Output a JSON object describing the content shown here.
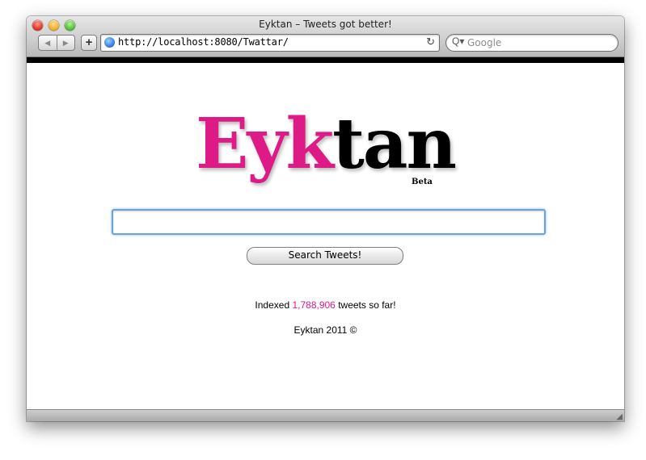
{
  "window": {
    "title": "Eyktan – Tweets got better!",
    "url": "http://localhost:8080/Twattar/",
    "search_placeholder": "Google"
  },
  "toolbar": {
    "back_glyph": "◀",
    "forward_glyph": "▶",
    "add_glyph": "+",
    "reload_glyph": "↻",
    "search_glyph": "Q▾",
    "icons": [
      "back-icon",
      "forward-icon",
      "plus-icon",
      "globe-icon",
      "reload-icon",
      "search-icon"
    ]
  },
  "logo": {
    "part1": "Eyk",
    "part2": "tan",
    "badge": "Beta",
    "colors": {
      "accent": "#de1a86",
      "dark": "#000000"
    }
  },
  "search": {
    "query_value": "",
    "button_label": "Search Tweets!"
  },
  "stats": {
    "prefix": "Indexed ",
    "count": "1,788,906",
    "suffix": " tweets so far!"
  },
  "footer": {
    "text": "Eyktan 2011 ©"
  }
}
